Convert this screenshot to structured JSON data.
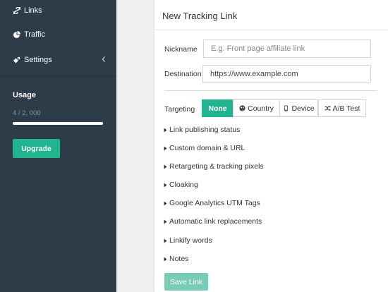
{
  "sidebar": {
    "nav": [
      {
        "label": "Links",
        "icon": "link-icon"
      },
      {
        "label": "Traffic",
        "icon": "pie-chart-icon"
      },
      {
        "label": "Settings",
        "icon": "cogs-icon"
      }
    ],
    "usage": {
      "title": "Usage",
      "count": "4 / 2, 000",
      "fraction": 0.002
    },
    "upgrade_label": "Upgrade"
  },
  "form": {
    "title": "New Tracking Link",
    "nickname": {
      "label": "Nickname",
      "placeholder": "E.g. Front page affiliate link",
      "value": ""
    },
    "destination": {
      "label": "Destination",
      "placeholder": "",
      "value": "https://www.example.com"
    },
    "targeting": {
      "label": "Targeting",
      "options": [
        {
          "label": "None",
          "icon": "",
          "active": true
        },
        {
          "label": "Country",
          "icon": "globe-icon",
          "active": false
        },
        {
          "label": "Device",
          "icon": "mobile-icon",
          "active": false
        },
        {
          "label": "A/B Test",
          "icon": "shuffle-icon",
          "active": false
        }
      ]
    },
    "sections": [
      "Link publishing status",
      "Custom domain & URL",
      "Retargeting & tracking pixels",
      "Cloaking",
      "Google Analytics UTM Tags",
      "Automatic link replacements",
      "Linkify words",
      "Notes"
    ],
    "save_label": "Save Link"
  },
  "colors": {
    "sidebar_bg": "#2e3b48",
    "accent": "#20b490",
    "save_disabled": "#79cdb6"
  }
}
